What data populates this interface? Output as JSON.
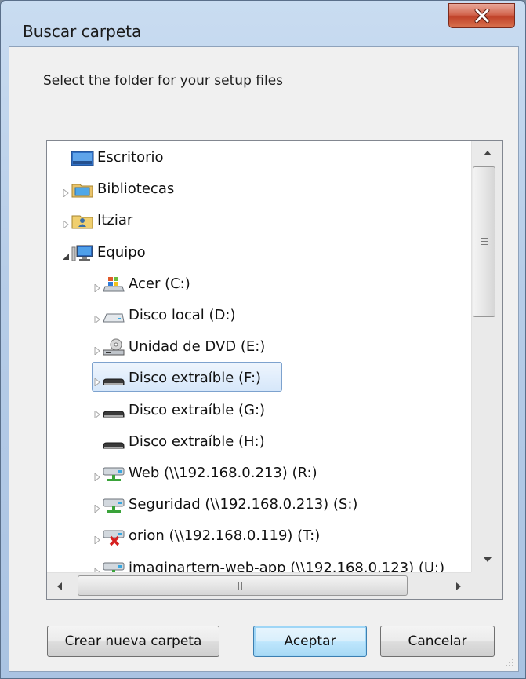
{
  "window": {
    "title": "Buscar carpeta",
    "close_label": "x"
  },
  "prompt": "Select the folder for your setup files",
  "tree": {
    "items": [
      {
        "label": "Escritorio",
        "icon": "desktop-icon",
        "level": 0,
        "arrow": "none"
      },
      {
        "label": "Bibliotecas",
        "icon": "libraries-icon",
        "level": 0,
        "arrow": "collapsed"
      },
      {
        "label": "Itziar",
        "icon": "user-folder-icon",
        "level": 0,
        "arrow": "collapsed"
      },
      {
        "label": "Equipo",
        "icon": "computer-icon",
        "level": 0,
        "arrow": "expanded"
      },
      {
        "label": "Acer (C:)",
        "icon": "windows-drive-icon",
        "level": 1,
        "arrow": "collapsed"
      },
      {
        "label": "Disco local (D:)",
        "icon": "hard-drive-icon",
        "level": 1,
        "arrow": "collapsed"
      },
      {
        "label": "Unidad de DVD (E:)",
        "icon": "dvd-drive-icon",
        "level": 1,
        "arrow": "collapsed"
      },
      {
        "label": "Disco extraíble (F:)",
        "icon": "removable-drive-icon",
        "level": 1,
        "arrow": "collapsed",
        "selected": true
      },
      {
        "label": "Disco extraíble (G:)",
        "icon": "removable-drive-icon",
        "level": 1,
        "arrow": "collapsed"
      },
      {
        "label": "Disco extraíble (H:)",
        "icon": "removable-drive-icon",
        "level": 1,
        "arrow": "none"
      },
      {
        "label": "Web (\\\\192.168.0.213) (R:)",
        "icon": "network-drive-icon",
        "level": 1,
        "arrow": "collapsed"
      },
      {
        "label": "Seguridad (\\\\192.168.0.213) (S:)",
        "icon": "network-drive-icon",
        "level": 1,
        "arrow": "collapsed"
      },
      {
        "label": "orion (\\\\192.168.0.119) (T:)",
        "icon": "disconnected-network-drive-icon",
        "level": 1,
        "arrow": "collapsed"
      },
      {
        "label": "imaginartern-web-app (\\\\192.168.0.123) (U:)",
        "icon": "network-drive-icon",
        "level": 1,
        "arrow": "collapsed"
      }
    ]
  },
  "buttons": {
    "new_folder": "Crear nueva carpeta",
    "ok": "Aceptar",
    "cancel": "Cancelar"
  },
  "colors": {
    "selection_border": "#7da2ce",
    "close_button": "#c0432a"
  }
}
